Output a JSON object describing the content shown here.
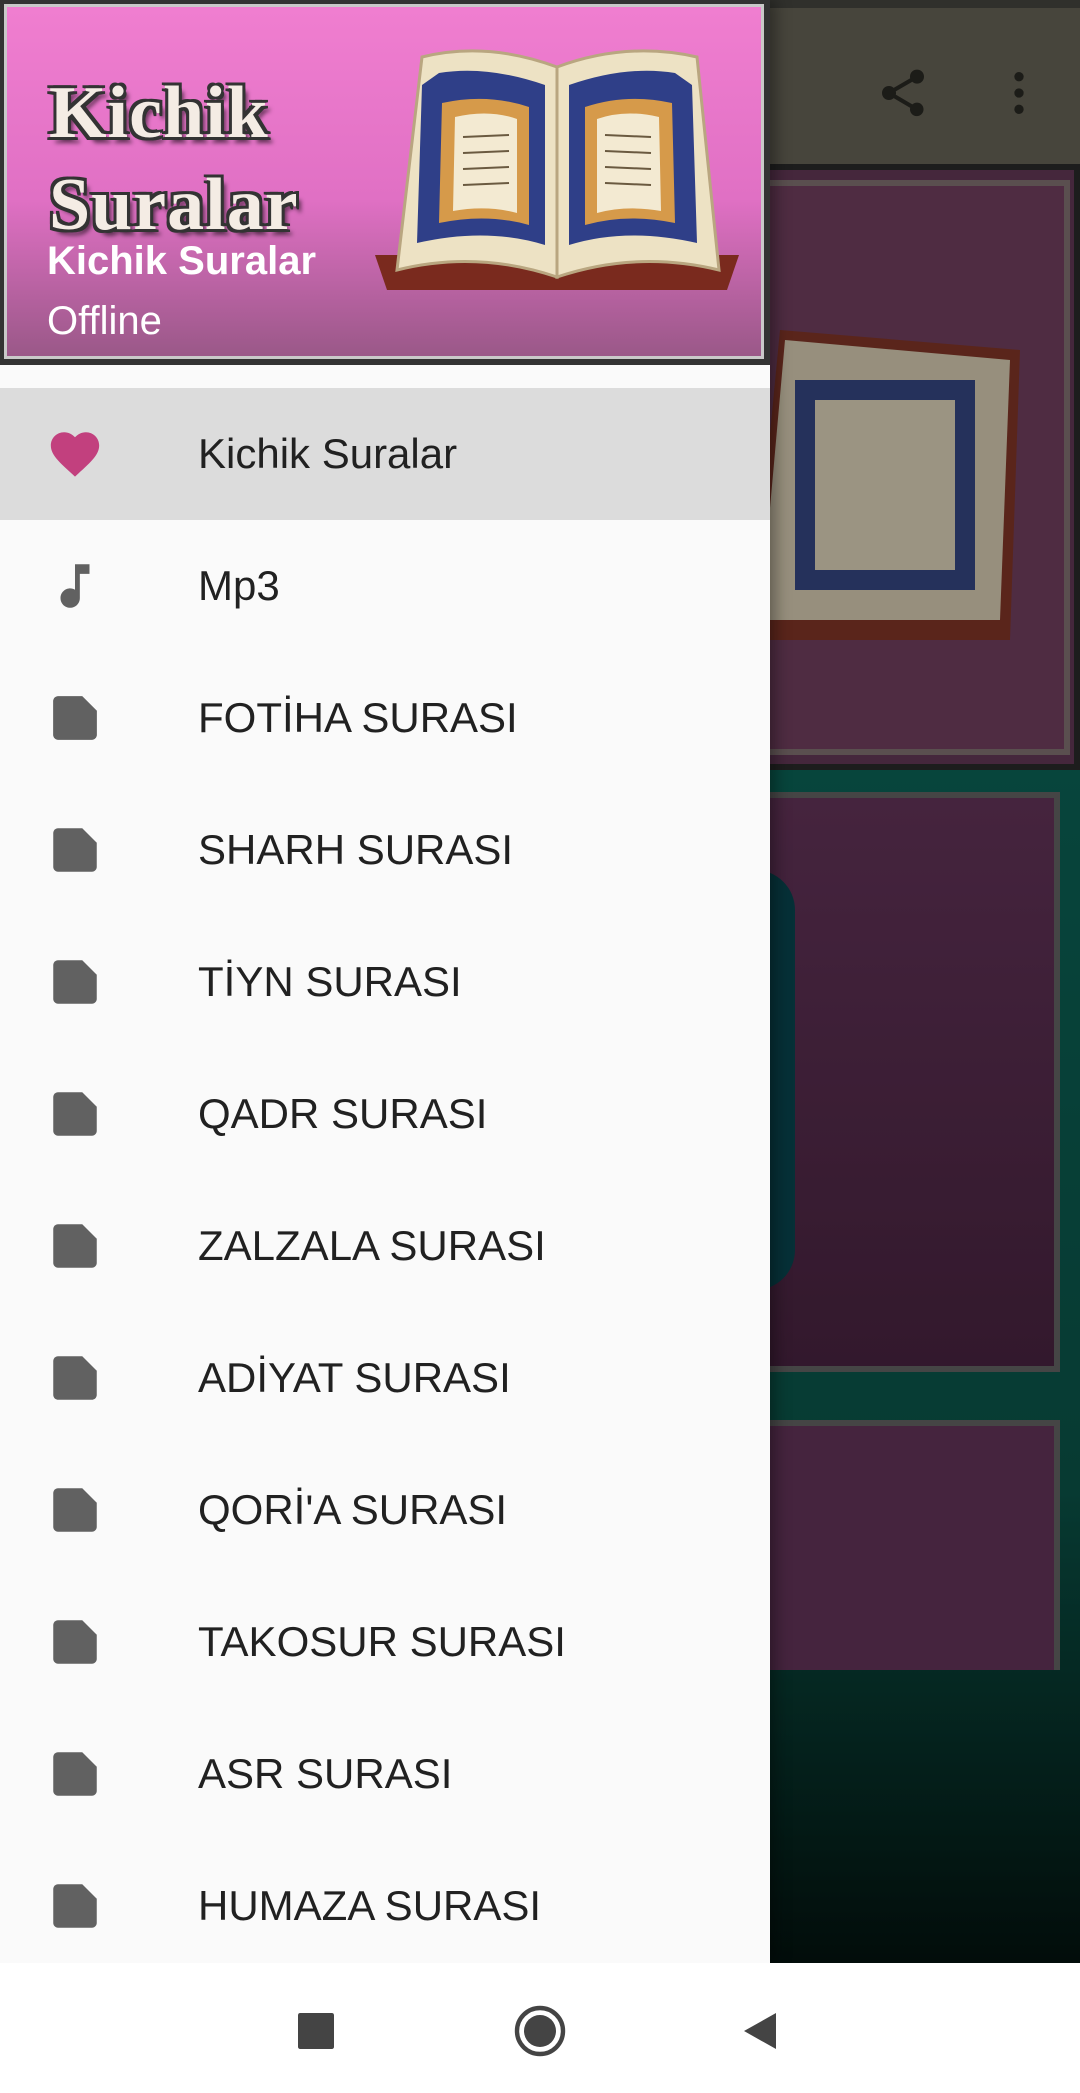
{
  "drawer": {
    "header": {
      "title_line1": "Kichik",
      "title_line2": "Suralar",
      "app_name": "Kichik Suralar",
      "subtitle": "Offline"
    },
    "items": [
      {
        "label": "Kichik Suralar",
        "icon": "heart-icon",
        "active": true
      },
      {
        "label": "Mp3",
        "icon": "music-note-icon"
      },
      {
        "label": "FOTİHA SURASI",
        "icon": "document-icon"
      },
      {
        "label": "SHARH SURASI",
        "icon": "document-icon"
      },
      {
        "label": "TİYN SURASI",
        "icon": "document-icon"
      },
      {
        "label": "QADR SURASI",
        "icon": "document-icon"
      },
      {
        "label": "ZALZALA SURASI",
        "icon": "document-icon"
      },
      {
        "label": "ADİYAT SURASI",
        "icon": "document-icon"
      },
      {
        "label": "QORİ'A SURASI",
        "icon": "document-icon"
      },
      {
        "label": "TAKOSUR SURASI",
        "icon": "document-icon"
      },
      {
        "label": "ASR SURASI",
        "icon": "document-icon"
      },
      {
        "label": "HUMAZA SURASI",
        "icon": "document-icon"
      }
    ]
  },
  "toolbar": {
    "actions": [
      "share-icon",
      "more-vert-icon"
    ]
  },
  "navbar": {
    "buttons": [
      "recents-square-icon",
      "home-circle-icon",
      "back-triangle-icon"
    ]
  },
  "colors": {
    "header_pink": "#f07ed0",
    "heart": "#c2407e",
    "icon_gray": "#616161",
    "active_row": "#dcdcdc"
  }
}
